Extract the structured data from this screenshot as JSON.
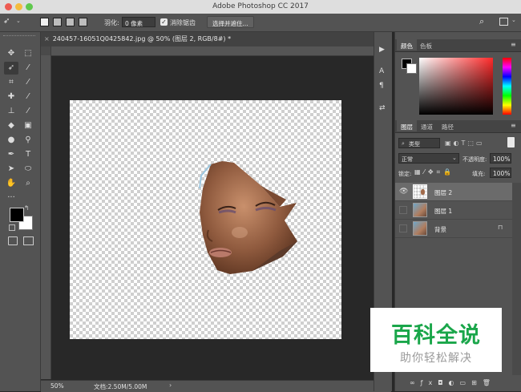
{
  "window": {
    "title": "Adobe Photoshop CC 2017"
  },
  "options_bar": {
    "feather_label": "羽化:",
    "feather_value": "0 像素",
    "antialias_label": "消除锯齿",
    "select_mask_button": "选择并遮住..."
  },
  "document": {
    "tab_label": "240457-16051Q0425842.jpg @ 50% (图层 2, RGB/8#) *",
    "zoom": "50%",
    "doc_info": "文档:2.50M/5.00M"
  },
  "color_panel": {
    "tabs": [
      "颜色",
      "色板"
    ]
  },
  "layers_panel": {
    "tabs": [
      "图层",
      "通道",
      "路径"
    ],
    "filter_label": "类型",
    "blend_mode": "正常",
    "opacity_label": "不透明度:",
    "opacity_value": "100%",
    "lock_label": "锁定:",
    "fill_label": "填充:",
    "fill_value": "100%",
    "layers": [
      {
        "name": "图层 2",
        "selected": true,
        "visible": true
      },
      {
        "name": "图层 1",
        "selected": false,
        "visible": false
      },
      {
        "name": "背景",
        "selected": false,
        "visible": false,
        "locked": true
      }
    ]
  },
  "watermark": {
    "title": "百科全说",
    "subtitle": "助你轻松解决"
  },
  "colors": {
    "foreground": "#000000",
    "background": "#ffffff",
    "accent": "#1aa64a"
  }
}
